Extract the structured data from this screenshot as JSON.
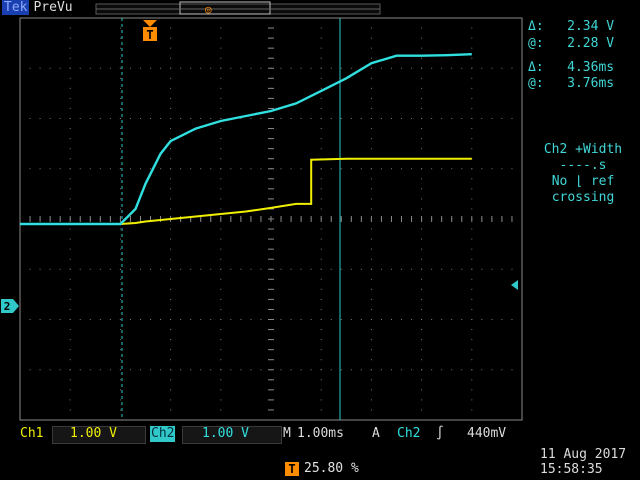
{
  "header": {
    "brand": "Tek",
    "mode": "PreVu"
  },
  "cursors": {
    "voltage_delta": "2.34 V",
    "voltage_at": "2.28 V",
    "time_delta": "4.36ms",
    "time_at": "3.76ms",
    "delta_symbol": "Δ:",
    "at_symbol": "@:"
  },
  "measurement": {
    "line1": "Ch2 +Width",
    "line2": "----.s",
    "line3": "No ⌊ ref",
    "line4": "crossing"
  },
  "channels": {
    "ch1_label": "Ch1",
    "ch1_scale": "1.00 V",
    "ch2_label": "Ch2",
    "ch2_scale": "1.00 V"
  },
  "timebase": {
    "label": "M",
    "value": "1.00ms"
  },
  "trigger": {
    "mode": "A",
    "source": "Ch2",
    "slope_symbol": "∫",
    "level": "440mV",
    "position": "25.80 %",
    "marker": "T"
  },
  "ground_marker": "2",
  "date": "11 Aug 2017",
  "time": "15:58:35",
  "colors": {
    "ch1": "#f0f000",
    "ch2": "#30e0e0",
    "grid": "#7a7a7a",
    "trigger": "#ff8c00",
    "readout": "#41d6d6"
  },
  "chart_data": {
    "type": "line",
    "x": [
      -2.0,
      -1.5,
      -1.0,
      0.0,
      0.3,
      0.5,
      0.8,
      1.0,
      1.5,
      2.0,
      2.5,
      3.0,
      3.5,
      4.0,
      4.5,
      5.0,
      5.5,
      6.0,
      6.5,
      7.0
    ],
    "series": [
      {
        "name": "Ch1",
        "values": [
          -0.1,
          -0.1,
          -0.1,
          -0.1,
          -0.08,
          -0.05,
          -0.02,
          0.0,
          0.05,
          0.1,
          0.15,
          0.22,
          0.3,
          1.18,
          1.2,
          1.2,
          1.2,
          1.2,
          1.2,
          1.2
        ]
      },
      {
        "name": "Ch2",
        "values": [
          -0.1,
          -0.1,
          -0.1,
          -0.1,
          0.2,
          0.7,
          1.3,
          1.55,
          1.8,
          1.95,
          2.05,
          2.15,
          2.3,
          2.55,
          2.8,
          3.1,
          3.25,
          3.25,
          3.26,
          3.28
        ]
      }
    ],
    "xlim": [
      -2.0,
      8.0
    ],
    "ylim": [
      -4,
      4
    ],
    "grid": true
  }
}
